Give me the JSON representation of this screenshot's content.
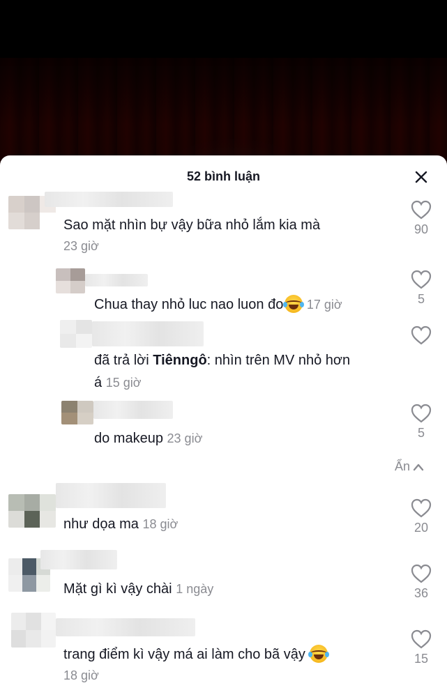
{
  "header": {
    "title": "52 bình luận",
    "close_icon": "close-icon"
  },
  "comments": [
    {
      "text": "Sao mặt nhìn bự vậy bữa nhỏ lắm kia mà",
      "time": "23 giờ",
      "likes": "90"
    },
    {
      "text": "Chua thay nhỏ luc nao luon đo",
      "time": "17 giờ",
      "likes": "5",
      "emoji": "laughing-tears-emoji"
    },
    {
      "reply_prefix": "đã trả lời ",
      "reply_to": "Tiênngô",
      "text": ": nhìn trên MV nhỏ hơn",
      "text2": "á",
      "time": "15 giờ",
      "likes": ""
    },
    {
      "text": "do makeup",
      "time": "23 giờ",
      "likes": "5"
    },
    {
      "text": "như dọa ma",
      "time": "18 giờ",
      "likes": "20"
    },
    {
      "text": "Mặt gì kì vậy chài",
      "time": "1 ngày",
      "likes": "36"
    },
    {
      "text": "trang điểm kì vậy má ai làm cho bã vậy",
      "time": "18 giờ",
      "likes": "15",
      "emoji": "laughing-tears-emoji"
    }
  ],
  "hide_replies": "Ẩn",
  "colors": {
    "text": "#161823",
    "muted": "#8a8b91",
    "sheet": "#ffffff"
  }
}
